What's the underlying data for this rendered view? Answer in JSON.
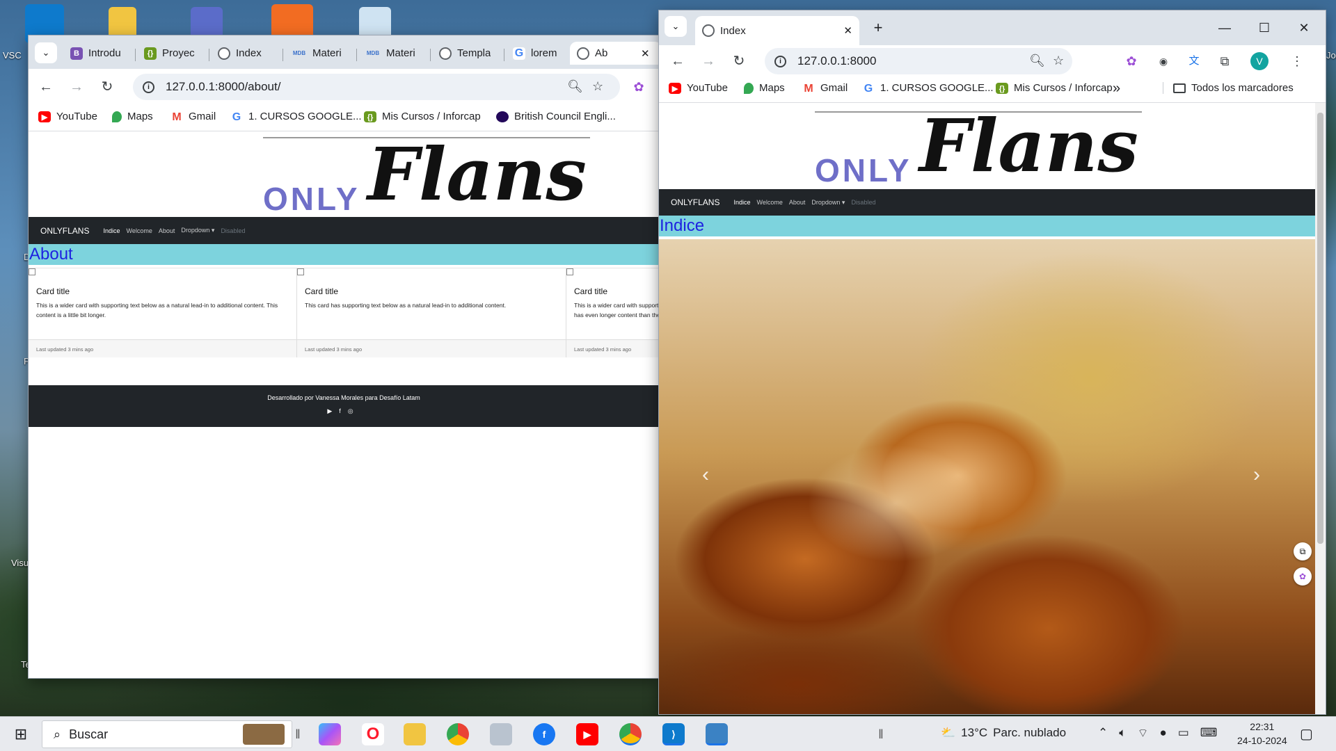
{
  "desktop": {
    "icon_labels": [
      "VSC",
      "D",
      "P",
      "Visu",
      "Te",
      "Jon"
    ]
  },
  "window_left": {
    "tabs": [
      {
        "label": "Introdu",
        "icon": "bootstrap-icon",
        "color": "#7952b3",
        "glyph": "B"
      },
      {
        "label": "Proyec",
        "icon": "inforcap-icon",
        "color": "#6a9a1f",
        "glyph": "{}"
      },
      {
        "label": "Index",
        "icon": "globe-icon"
      },
      {
        "label": "Materi",
        "icon": "mdb-icon",
        "color": "#3b71ca",
        "glyph": "MDB"
      },
      {
        "label": "Materi",
        "icon": "mdb-icon",
        "color": "#3b71ca",
        "glyph": "MDB"
      },
      {
        "label": "Templa",
        "icon": "globe-icon"
      },
      {
        "label": "lorem",
        "icon": "google-icon"
      },
      {
        "label": "Ab",
        "icon": "globe-icon",
        "active": true
      }
    ],
    "new_tab": "+",
    "url": "127.0.0.1:8000/about/",
    "bookmarks": [
      {
        "label": "YouTube",
        "icon": "youtube-icon",
        "color": "#ff0000"
      },
      {
        "label": "Maps",
        "icon": "maps-icon",
        "color": "#34a853"
      },
      {
        "label": "Gmail",
        "icon": "gmail-icon",
        "color": "#ea4335"
      },
      {
        "label": "1. CURSOS GOOGLE...",
        "icon": "google-icon"
      },
      {
        "label": "Mis Cursos / Inforcap",
        "icon": "inforcap-icon",
        "color": "#6a9a1f"
      },
      {
        "label": "British Council Engli...",
        "icon": "british-council-icon",
        "color": "#23085a"
      }
    ],
    "page": {
      "logo_only": "ONLY",
      "logo_flans": "Flans",
      "brand": "ONLYFLANS",
      "nav": [
        {
          "label": "Indice",
          "state": "active"
        },
        {
          "label": "Welcome",
          "state": "normal"
        },
        {
          "label": "About",
          "state": "normal"
        },
        {
          "label": "Dropdown ▾",
          "state": "normal"
        },
        {
          "label": "Disabled",
          "state": "disabled"
        }
      ],
      "heading": "About",
      "cards": [
        {
          "title": "Card title",
          "text": "This is a wider card with supporting text below as a natural lead-in to additional content. This content is a little bit longer.",
          "footer": "Last updated 3 mins ago"
        },
        {
          "title": "Card title",
          "text": "This card has supporting text below as a natural lead-in to additional content.",
          "footer": "Last updated 3 mins ago"
        },
        {
          "title": "Card title",
          "text": "This is a wider card with supporting text below as a natural lead-in to additional content. This card has even longer content than the first to show that equal height action.",
          "footer": "Last updated 3 mins ago"
        }
      ],
      "footer_text": "Desarrollado por Vanessa Morales para Desafío Latam",
      "footer_icons": [
        "youtube-icon",
        "facebook-icon",
        "instagram-icon"
      ]
    }
  },
  "window_right": {
    "tab": {
      "label": "Index",
      "icon": "globe-icon"
    },
    "new_tab": "+",
    "url": "127.0.0.1:8000",
    "profile_initial": "V",
    "bookmarks": [
      {
        "label": "YouTube",
        "icon": "youtube-icon",
        "color": "#ff0000"
      },
      {
        "label": "Maps",
        "icon": "maps-icon",
        "color": "#34a853"
      },
      {
        "label": "Gmail",
        "icon": "gmail-icon",
        "color": "#ea4335"
      },
      {
        "label": "1. CURSOS GOOGLE...",
        "icon": "google-icon"
      },
      {
        "label": "Mis Cursos / Inforcap",
        "icon": "inforcap-icon",
        "color": "#6a9a1f"
      }
    ],
    "bookmarks_overflow": "»",
    "all_bookmarks": "Todos los marcadores",
    "page": {
      "logo_only": "ONLY",
      "logo_flans": "Flans",
      "brand": "ONLYFLANS",
      "nav": [
        {
          "label": "Indice",
          "state": "active"
        },
        {
          "label": "Welcome",
          "state": "normal"
        },
        {
          "label": "About",
          "state": "normal"
        },
        {
          "label": "Dropdown ▾",
          "state": "normal"
        },
        {
          "label": "Disabled",
          "state": "disabled"
        }
      ],
      "heading": "Indice",
      "carousel_prev": "‹",
      "carousel_next": "›"
    }
  },
  "taskbar": {
    "search_placeholder": "Buscar",
    "apps": [
      "copilot-icon",
      "opera-icon",
      "file-explorer-icon",
      "chrome-icon",
      "app-icon",
      "facebook-icon",
      "youtube-icon",
      "chrome-profile-icon",
      "vscode-icon",
      "photos-icon"
    ],
    "weather_temp": "13°C",
    "weather_text": "Parc. nublado",
    "time": "22:31",
    "date": "24-10-2024"
  },
  "colors": {
    "navbar": "#212529",
    "heading_bg": "#7dd3dd",
    "heading_text": "#1e22e0",
    "logo_only": "#6f6fc8"
  }
}
